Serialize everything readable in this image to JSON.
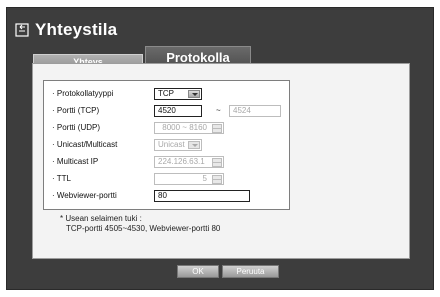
{
  "window": {
    "title": "Yhteystila"
  },
  "tabs": [
    {
      "label": "Yhteys",
      "active": false
    },
    {
      "label": "Protokolla",
      "active": true
    }
  ],
  "form": {
    "protokollatyyppi": {
      "label": "· Protokollatyyppi",
      "value": "TCP"
    },
    "portti_tcp": {
      "label": "· Portti (TCP)",
      "value_from": "4520",
      "value_to": "4524",
      "separator": "~"
    },
    "portti_udp": {
      "label": "· Portti (UDP)",
      "value": "8000 ~ 8160"
    },
    "unicast_multicast": {
      "label": "· Unicast/Multicast",
      "value": "Unicast"
    },
    "multicast_ip": {
      "label": "· Multicast IP",
      "value": "224.126.63.1"
    },
    "ttl": {
      "label": "· TTL",
      "value": "5"
    },
    "webviewer_portti": {
      "label": "· Webviewer-portti",
      "value": "80"
    }
  },
  "note": {
    "line1": "* Usean selaimen tuki :",
    "line2": "TCP-portti 4505~4530, Webviewer-portti 80"
  },
  "buttons": {
    "ok": "OK",
    "cancel": "Peruuta"
  },
  "colors": {
    "window_bg": "#3d3d3d",
    "panel_bg": "#f3f3f3",
    "tab_active": "#4a4a4a",
    "tab_inactive": "#8e8e8e"
  }
}
